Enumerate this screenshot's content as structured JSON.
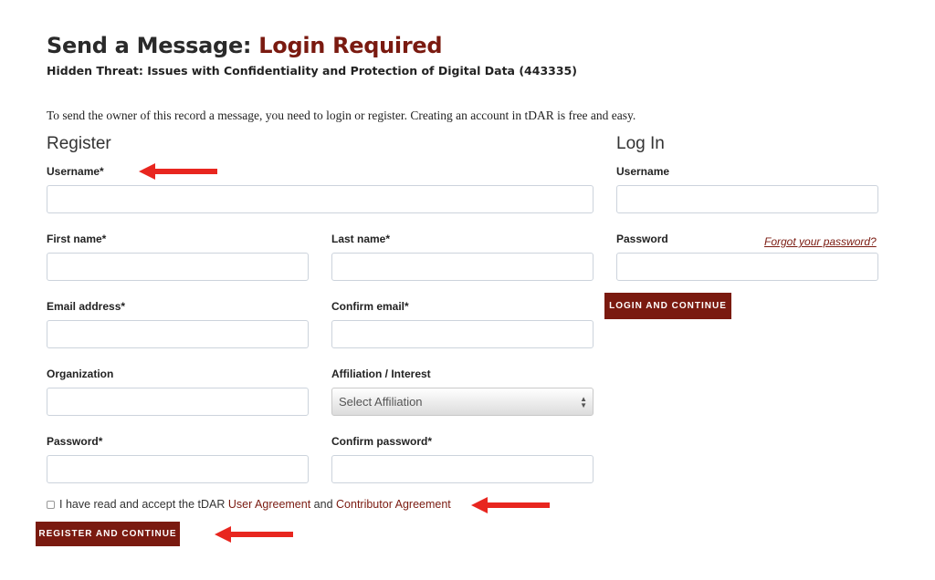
{
  "header": {
    "title_prefix": "Send a Message:",
    "title_accent": "Login Required",
    "subtitle": "Hidden Threat: Issues with Confidentiality and Protection of Digital Data (443335)",
    "intro": "To send the owner of this record a message, you need to login or register. Creating an account in tDAR is free and easy."
  },
  "register": {
    "heading": "Register",
    "fields": {
      "username": {
        "label": "Username*",
        "value": ""
      },
      "first_name": {
        "label": "First name*",
        "value": ""
      },
      "last_name": {
        "label": "Last name*",
        "value": ""
      },
      "email": {
        "label": "Email address*",
        "value": ""
      },
      "confirm_email": {
        "label": "Confirm email*",
        "value": ""
      },
      "organization": {
        "label": "Organization",
        "value": ""
      },
      "affiliation": {
        "label": "Affiliation / Interest",
        "selected": "Select Affiliation"
      },
      "password": {
        "label": "Password*",
        "value": ""
      },
      "confirm_password": {
        "label": "Confirm password*",
        "value": ""
      }
    },
    "agreement": {
      "text": "I have read and accept the tDAR",
      "user_agreement_link": "User Agreement",
      "and": "and",
      "contributor_agreement_link": "Contributor Agreement",
      "checked": false
    },
    "submit_label": "REGISTER AND CONTINUE"
  },
  "login": {
    "heading": "Log In",
    "username_label": "Username",
    "password_label": "Password",
    "forgot_link": "Forgot your password?",
    "submit_label": "LOGIN AND CONTINUE"
  },
  "colors": {
    "accent": "#7a1a10",
    "annotation_arrow": "#e8261f"
  }
}
